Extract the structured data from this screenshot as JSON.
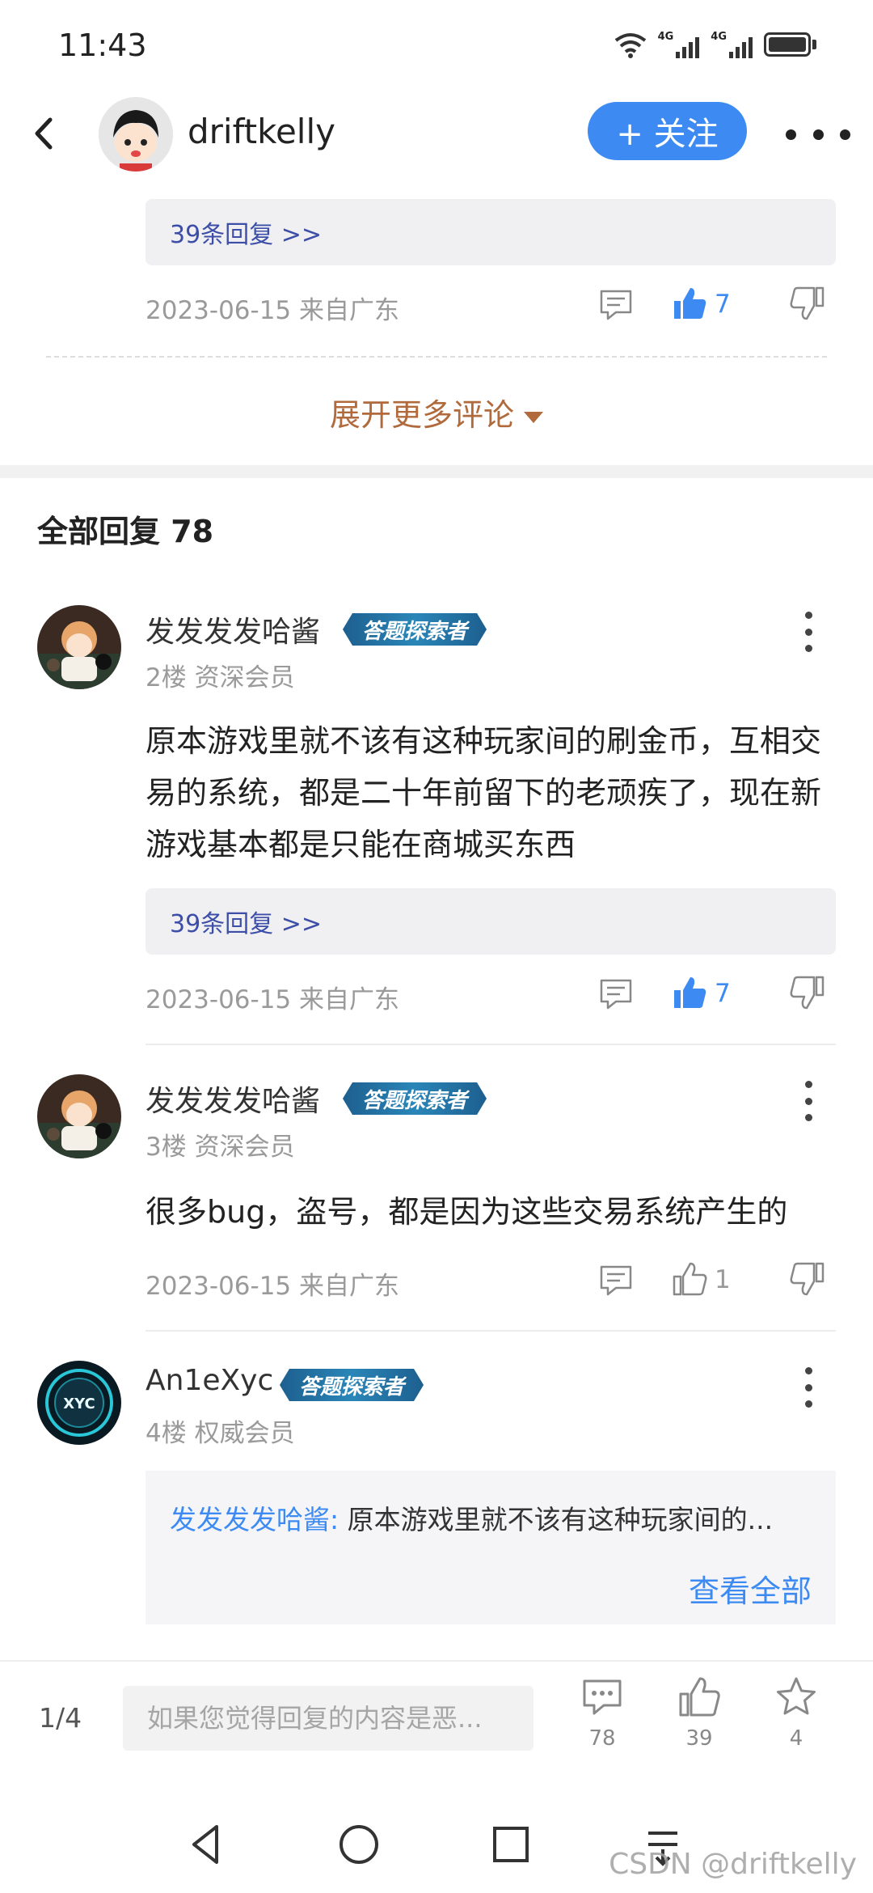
{
  "status": {
    "time": "11:43",
    "network_1": "4G",
    "network_2": "4G"
  },
  "header": {
    "username": "driftkelly",
    "follow_label": "+ 关注"
  },
  "prev_comment": {
    "reply_link": "39条回复 >>",
    "meta": "2023-06-15 来自广东",
    "likes": "7"
  },
  "expand_more_label": "展开更多评论",
  "all_replies_label": "全部回复  78",
  "comments": [
    {
      "username": "发发发发哈酱",
      "badge": "答题探索者",
      "floor": "2楼 资深会员",
      "body": "原本游戏里就不该有这种玩家间的刷金币，互相交易的系统，都是二十年前留下的老顽疾了，现在新游戏基本都是只能在商城买东西",
      "reply_link": "39条回复 >>",
      "meta": "2023-06-15 来自广东",
      "likes": "7"
    },
    {
      "username": "发发发发哈酱",
      "badge": "答题探索者",
      "floor": "3楼 资深会员",
      "body": "很多bug，盗号，都是因为这些交易系统产生的",
      "meta": "2023-06-15 来自广东",
      "likes": "1"
    },
    {
      "username": "An1eXyc",
      "badge": "答题探索者",
      "floor": "4楼 权威会员",
      "quote_name": "发发发发哈酱:",
      "quote_text": " 原本游戏里就不该有这种玩家间的...",
      "quote_view_all": "查看全部",
      "avatar_text": "XYC"
    }
  ],
  "bottom_bar": {
    "page_indicator": "1/4",
    "input_placeholder": "如果您觉得回复的内容是恶...",
    "comment_count": "78",
    "like_count": "39",
    "star_count": "4"
  },
  "watermark": "CSDN @driftkelly",
  "colors": {
    "accent": "#3d8bf2",
    "expand": "#b06a3b",
    "reply_link": "#3c4ea8",
    "badge": "#2a86b8"
  }
}
